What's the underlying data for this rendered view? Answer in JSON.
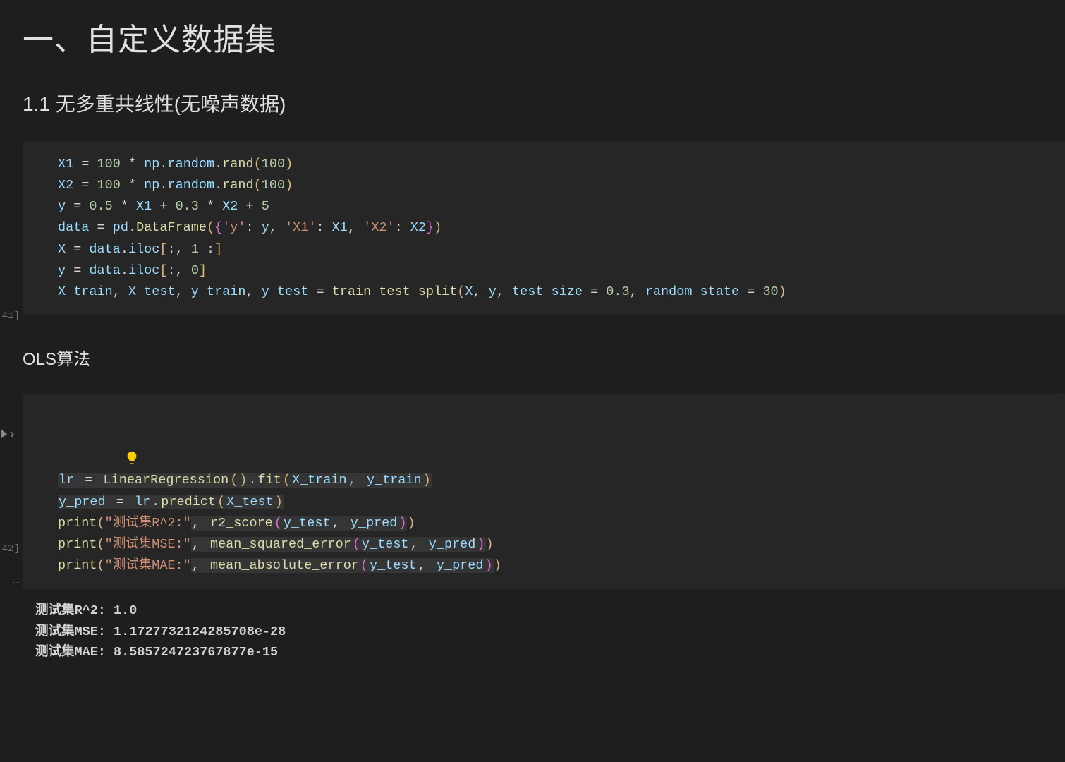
{
  "headings": {
    "h1": "一、自定义数据集",
    "h2": "1.1 无多重共线性(无噪声数据)",
    "h3": "OLS算法"
  },
  "gutter": {
    "cell1_label": "41]",
    "cell2_label": "42]",
    "output_marker": "…"
  },
  "code_cell_1": {
    "lines": [
      [
        {
          "t": "X1",
          "c": "tk-id"
        },
        {
          "t": " = ",
          "c": "tk-op"
        },
        {
          "t": "100",
          "c": "tk-num"
        },
        {
          "t": " * ",
          "c": "tk-op"
        },
        {
          "t": "np",
          "c": "tk-id"
        },
        {
          "t": ".",
          "c": "tk-punc"
        },
        {
          "t": "random",
          "c": "tk-id"
        },
        {
          "t": ".",
          "c": "tk-punc"
        },
        {
          "t": "rand",
          "c": "tk-func"
        },
        {
          "t": "(",
          "c": "tk-paren"
        },
        {
          "t": "100",
          "c": "tk-num"
        },
        {
          "t": ")",
          "c": "tk-paren"
        }
      ],
      [
        {
          "t": "X2",
          "c": "tk-id"
        },
        {
          "t": " = ",
          "c": "tk-op"
        },
        {
          "t": "100",
          "c": "tk-num"
        },
        {
          "t": " * ",
          "c": "tk-op"
        },
        {
          "t": "np",
          "c": "tk-id"
        },
        {
          "t": ".",
          "c": "tk-punc"
        },
        {
          "t": "random",
          "c": "tk-id"
        },
        {
          "t": ".",
          "c": "tk-punc"
        },
        {
          "t": "rand",
          "c": "tk-func"
        },
        {
          "t": "(",
          "c": "tk-paren"
        },
        {
          "t": "100",
          "c": "tk-num"
        },
        {
          "t": ")",
          "c": "tk-paren"
        }
      ],
      [
        {
          "t": "y",
          "c": "tk-id"
        },
        {
          "t": " = ",
          "c": "tk-op"
        },
        {
          "t": "0.5",
          "c": "tk-num"
        },
        {
          "t": " * ",
          "c": "tk-op"
        },
        {
          "t": "X1",
          "c": "tk-id"
        },
        {
          "t": " + ",
          "c": "tk-op"
        },
        {
          "t": "0.3",
          "c": "tk-num"
        },
        {
          "t": " * ",
          "c": "tk-op"
        },
        {
          "t": "X2",
          "c": "tk-id"
        },
        {
          "t": " + ",
          "c": "tk-op"
        },
        {
          "t": "5",
          "c": "tk-num"
        }
      ],
      [
        {
          "t": "data",
          "c": "tk-id"
        },
        {
          "t": " = ",
          "c": "tk-op"
        },
        {
          "t": "pd",
          "c": "tk-id"
        },
        {
          "t": ".",
          "c": "tk-punc"
        },
        {
          "t": "DataFrame",
          "c": "tk-func"
        },
        {
          "t": "(",
          "c": "tk-paren"
        },
        {
          "t": "{",
          "c": "tk-brace"
        },
        {
          "t": "'y'",
          "c": "tk-str"
        },
        {
          "t": ": ",
          "c": "tk-punc"
        },
        {
          "t": "y",
          "c": "tk-id"
        },
        {
          "t": ", ",
          "c": "tk-punc"
        },
        {
          "t": "'X1'",
          "c": "tk-str"
        },
        {
          "t": ": ",
          "c": "tk-punc"
        },
        {
          "t": "X1",
          "c": "tk-id"
        },
        {
          "t": ", ",
          "c": "tk-punc"
        },
        {
          "t": "'X2'",
          "c": "tk-str"
        },
        {
          "t": ": ",
          "c": "tk-punc"
        },
        {
          "t": "X2",
          "c": "tk-id"
        },
        {
          "t": "}",
          "c": "tk-brace"
        },
        {
          "t": ")",
          "c": "tk-paren"
        }
      ],
      [
        {
          "t": "X",
          "c": "tk-id"
        },
        {
          "t": " = ",
          "c": "tk-op"
        },
        {
          "t": "data",
          "c": "tk-id"
        },
        {
          "t": ".",
          "c": "tk-punc"
        },
        {
          "t": "iloc",
          "c": "tk-id"
        },
        {
          "t": "[",
          "c": "tk-paren"
        },
        {
          "t": ":",
          "c": "tk-punc"
        },
        {
          "t": ", ",
          "c": "tk-punc"
        },
        {
          "t": "1",
          "c": "tk-num"
        },
        {
          "t": " :",
          "c": "tk-punc"
        },
        {
          "t": "]",
          "c": "tk-paren"
        }
      ],
      [
        {
          "t": "y",
          "c": "tk-id"
        },
        {
          "t": " = ",
          "c": "tk-op"
        },
        {
          "t": "data",
          "c": "tk-id"
        },
        {
          "t": ".",
          "c": "tk-punc"
        },
        {
          "t": "iloc",
          "c": "tk-id"
        },
        {
          "t": "[",
          "c": "tk-paren"
        },
        {
          "t": ":",
          "c": "tk-punc"
        },
        {
          "t": ", ",
          "c": "tk-punc"
        },
        {
          "t": "0",
          "c": "tk-num"
        },
        {
          "t": "]",
          "c": "tk-paren"
        }
      ],
      [
        {
          "t": "X_train",
          "c": "tk-id"
        },
        {
          "t": ", ",
          "c": "tk-punc"
        },
        {
          "t": "X_test",
          "c": "tk-id"
        },
        {
          "t": ", ",
          "c": "tk-punc"
        },
        {
          "t": "y_train",
          "c": "tk-id"
        },
        {
          "t": ", ",
          "c": "tk-punc"
        },
        {
          "t": "y_test",
          "c": "tk-id"
        },
        {
          "t": " = ",
          "c": "tk-op"
        },
        {
          "t": "train_test_split",
          "c": "tk-func"
        },
        {
          "t": "(",
          "c": "tk-paren"
        },
        {
          "t": "X",
          "c": "tk-id"
        },
        {
          "t": ", ",
          "c": "tk-punc"
        },
        {
          "t": "y",
          "c": "tk-id"
        },
        {
          "t": ", ",
          "c": "tk-punc"
        },
        {
          "t": "test_size",
          "c": "tk-id"
        },
        {
          "t": " = ",
          "c": "tk-op"
        },
        {
          "t": "0.3",
          "c": "tk-num"
        },
        {
          "t": ", ",
          "c": "tk-punc"
        },
        {
          "t": "random_state",
          "c": "tk-id"
        },
        {
          "t": " = ",
          "c": "tk-op"
        },
        {
          "t": "30",
          "c": "tk-num"
        },
        {
          "t": ")",
          "c": "tk-paren"
        }
      ]
    ]
  },
  "code_cell_2": {
    "lines": [
      [
        {
          "t": "lr",
          "c": "tk-id",
          "sel": true
        },
        {
          "t": " ",
          "c": "tk-op",
          "sel": true
        },
        {
          "t": "=",
          "c": "tk-op",
          "sel": true
        },
        {
          "t": " ",
          "c": "tk-op",
          "sel": true
        },
        {
          "t": "LinearRegression",
          "c": "tk-func",
          "sel": true
        },
        {
          "t": "(",
          "c": "tk-paren",
          "sel": true
        },
        {
          "t": ")",
          "c": "tk-paren",
          "sel": true
        },
        {
          "t": ".",
          "c": "tk-punc",
          "sel": true
        },
        {
          "t": "fit",
          "c": "tk-func",
          "sel": true
        },
        {
          "t": "(",
          "c": "tk-paren",
          "sel": true
        },
        {
          "t": "X_train",
          "c": "tk-id",
          "sel": true
        },
        {
          "t": ",",
          "c": "tk-punc",
          "sel": true
        },
        {
          "t": " ",
          "c": "tk-op",
          "sel": true
        },
        {
          "t": "y_train",
          "c": "tk-id",
          "sel": true
        },
        {
          "t": ")",
          "c": "tk-paren",
          "sel": true
        }
      ],
      [
        {
          "t": "y_pred",
          "c": "tk-id",
          "sel": true
        },
        {
          "t": " ",
          "c": "tk-op",
          "sel": true
        },
        {
          "t": "=",
          "c": "tk-op",
          "sel": true
        },
        {
          "t": " ",
          "c": "tk-op",
          "sel": true
        },
        {
          "t": "lr",
          "c": "tk-id",
          "sel": true
        },
        {
          "t": ".",
          "c": "tk-punc",
          "sel": true
        },
        {
          "t": "predict",
          "c": "tk-func",
          "sel": true
        },
        {
          "t": "(",
          "c": "tk-paren",
          "sel": true
        },
        {
          "t": "X_test",
          "c": "tk-id",
          "sel": true
        },
        {
          "t": ")",
          "c": "tk-paren",
          "sel": true
        }
      ],
      [
        {
          "t": "print",
          "c": "tk-func"
        },
        {
          "t": "(",
          "c": "tk-paren"
        },
        {
          "t": "\"测试集R^2:\"",
          "c": "tk-str"
        },
        {
          "t": ",",
          "c": "tk-punc",
          "sel": true
        },
        {
          "t": " ",
          "c": "tk-op",
          "sel": true
        },
        {
          "t": "r2_score",
          "c": "tk-func",
          "sel": true
        },
        {
          "t": "(",
          "c": "tk-paren2",
          "sel": true
        },
        {
          "t": "y_test",
          "c": "tk-id",
          "sel": true
        },
        {
          "t": ",",
          "c": "tk-punc",
          "sel": true
        },
        {
          "t": " ",
          "c": "tk-op",
          "sel": true
        },
        {
          "t": "y_pred",
          "c": "tk-id",
          "sel": true
        },
        {
          "t": ")",
          "c": "tk-paren2",
          "sel": true
        },
        {
          "t": ")",
          "c": "tk-paren"
        }
      ],
      [
        {
          "t": "print",
          "c": "tk-func"
        },
        {
          "t": "(",
          "c": "tk-paren"
        },
        {
          "t": "\"测试集MSE:\"",
          "c": "tk-str"
        },
        {
          "t": ",",
          "c": "tk-punc",
          "sel": true
        },
        {
          "t": " ",
          "c": "tk-op",
          "sel": true
        },
        {
          "t": "mean_squared_error",
          "c": "tk-func",
          "sel": true
        },
        {
          "t": "(",
          "c": "tk-paren2",
          "sel": true
        },
        {
          "t": "y_test",
          "c": "tk-id",
          "sel": true
        },
        {
          "t": ",",
          "c": "tk-punc",
          "sel": true
        },
        {
          "t": " ",
          "c": "tk-op",
          "sel": true
        },
        {
          "t": "y_pred",
          "c": "tk-id",
          "sel": true
        },
        {
          "t": ")",
          "c": "tk-paren2",
          "sel": true
        },
        {
          "t": ")",
          "c": "tk-paren"
        }
      ],
      [
        {
          "t": "print",
          "c": "tk-func"
        },
        {
          "t": "(",
          "c": "tk-paren"
        },
        {
          "t": "\"测试集MAE:\"",
          "c": "tk-str"
        },
        {
          "t": ",",
          "c": "tk-punc",
          "sel": true
        },
        {
          "t": " ",
          "c": "tk-op",
          "sel": true
        },
        {
          "t": "mean_absolute_error",
          "c": "tk-func",
          "sel": true
        },
        {
          "t": "(",
          "c": "tk-paren2",
          "sel": true
        },
        {
          "t": "y_test",
          "c": "tk-id",
          "sel": true
        },
        {
          "t": ",",
          "c": "tk-punc",
          "sel": true
        },
        {
          "t": " ",
          "c": "tk-op",
          "sel": true
        },
        {
          "t": "y_pred",
          "c": "tk-id",
          "sel": true
        },
        {
          "t": ")",
          "c": "tk-paren2",
          "sel": true
        },
        {
          "t": ")",
          "c": "tk-paren"
        }
      ]
    ]
  },
  "output_cell": {
    "lines": [
      "测试集R^2: 1.0",
      "测试集MSE: 1.1727732124285708e-28",
      "测试集MAE: 8.585724723767877e-15"
    ]
  }
}
